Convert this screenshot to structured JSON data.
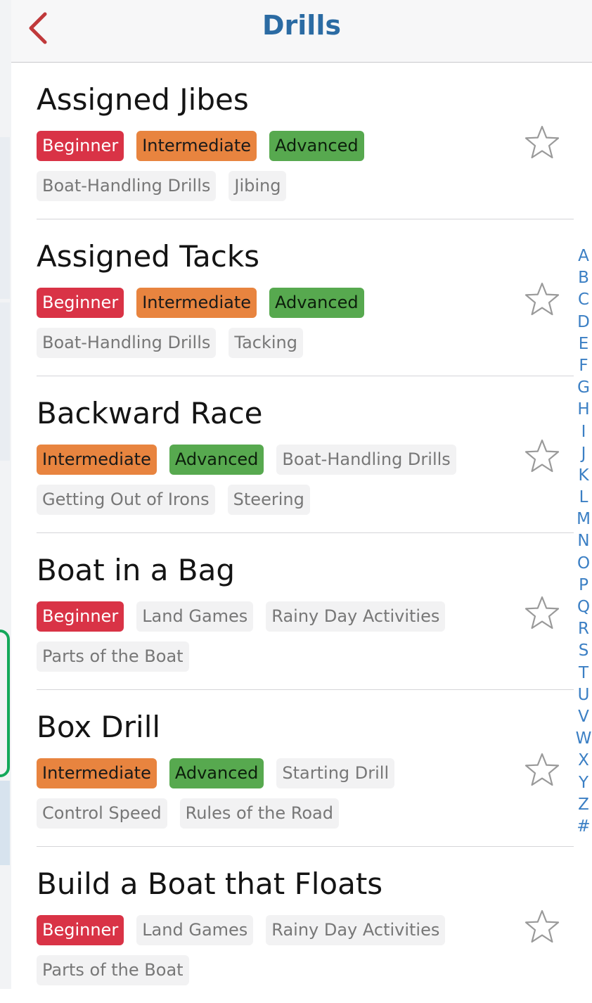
{
  "nav": {
    "title": "Drills",
    "back_icon": "chevron-left-icon"
  },
  "colors": {
    "title": "#2b6ba3",
    "back": "#c0393b",
    "beginner": "#d93346",
    "intermediate": "#e8843f",
    "advanced": "#57a94f",
    "category": "#f2f2f3",
    "index": "#3b7fc4"
  },
  "drills": [
    {
      "title": "Assigned Jibes",
      "tags": [
        {
          "label": "Beginner",
          "kind": "beginner"
        },
        {
          "label": "Intermediate",
          "kind": "intermediate"
        },
        {
          "label": "Advanced",
          "kind": "advanced"
        },
        {
          "label": "Boat-Handling Drills",
          "kind": "category"
        },
        {
          "label": "Jibing",
          "kind": "category"
        }
      ]
    },
    {
      "title": "Assigned Tacks",
      "tags": [
        {
          "label": "Beginner",
          "kind": "beginner"
        },
        {
          "label": "Intermediate",
          "kind": "intermediate"
        },
        {
          "label": "Advanced",
          "kind": "advanced"
        },
        {
          "label": "Boat-Handling Drills",
          "kind": "category"
        },
        {
          "label": "Tacking",
          "kind": "category"
        }
      ]
    },
    {
      "title": "Backward Race",
      "tags": [
        {
          "label": "Intermediate",
          "kind": "intermediate"
        },
        {
          "label": "Advanced",
          "kind": "advanced"
        },
        {
          "label": "Boat-Handling Drills",
          "kind": "category"
        },
        {
          "label": "Getting Out of Irons",
          "kind": "category"
        },
        {
          "label": "Steering",
          "kind": "category"
        }
      ]
    },
    {
      "title": "Boat in a Bag",
      "tags": [
        {
          "label": "Beginner",
          "kind": "beginner"
        },
        {
          "label": "Land Games",
          "kind": "category"
        },
        {
          "label": "Rainy Day Activities",
          "kind": "category"
        },
        {
          "label": "Parts of the Boat",
          "kind": "category"
        }
      ]
    },
    {
      "title": "Box Drill",
      "tags": [
        {
          "label": "Intermediate",
          "kind": "intermediate"
        },
        {
          "label": "Advanced",
          "kind": "advanced"
        },
        {
          "label": "Starting Drill",
          "kind": "category"
        },
        {
          "label": "Control Speed",
          "kind": "category"
        },
        {
          "label": "Rules of the Road",
          "kind": "category"
        }
      ]
    },
    {
      "title": "Build a Boat that Floats",
      "tags": [
        {
          "label": "Beginner",
          "kind": "beginner"
        },
        {
          "label": "Land Games",
          "kind": "category"
        },
        {
          "label": "Rainy Day Activities",
          "kind": "category"
        },
        {
          "label": "Parts of the Boat",
          "kind": "category"
        }
      ]
    }
  ],
  "favorite_icon": "star-outline-icon",
  "index": [
    "A",
    "B",
    "C",
    "D",
    "E",
    "F",
    "G",
    "H",
    "I",
    "J",
    "K",
    "L",
    "M",
    "N",
    "O",
    "P",
    "Q",
    "R",
    "S",
    "T",
    "U",
    "V",
    "W",
    "X",
    "Y",
    "Z",
    "#"
  ]
}
